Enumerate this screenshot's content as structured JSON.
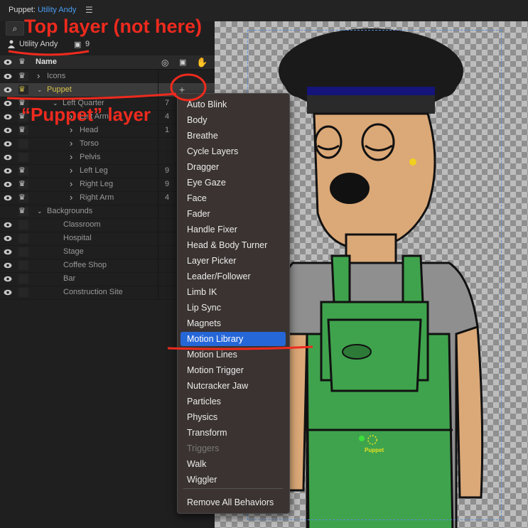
{
  "window": {
    "title_prefix": "Puppet:",
    "title_name": "Utility Andy",
    "menu_icon": "hamburger-icon"
  },
  "puppet_panel": {
    "search_icon": "search-icon",
    "puppet_name": "Utility Andy",
    "count": "9"
  },
  "layers": {
    "header": {
      "name_label": "Name"
    },
    "rows": [
      {
        "label": "Icons",
        "count": ""
      },
      {
        "label": "Puppet",
        "count": ""
      },
      {
        "label": "Left Quarter",
        "count": "7"
      },
      {
        "label": "Left Arm",
        "count": "4"
      },
      {
        "label": "Head",
        "count": "1"
      },
      {
        "label": "Torso",
        "count": ""
      },
      {
        "label": "Pelvis",
        "count": ""
      },
      {
        "label": "Left Leg",
        "count": "9"
      },
      {
        "label": "Right Leg",
        "count": "9"
      },
      {
        "label": "Right Arm",
        "count": "4"
      },
      {
        "label": "Backgrounds",
        "count": ""
      },
      {
        "label": "Classroom",
        "count": ""
      },
      {
        "label": "Hospital",
        "count": ""
      },
      {
        "label": "Stage",
        "count": ""
      },
      {
        "label": "Coffee Shop",
        "count": ""
      },
      {
        "label": "Bar",
        "count": ""
      },
      {
        "label": "Construction Site",
        "count": ""
      }
    ]
  },
  "behaviors_menu": {
    "add_symbol": "+",
    "items": [
      "Auto Blink",
      "Body",
      "Breathe",
      "Cycle Layers",
      "Dragger",
      "Eye Gaze",
      "Face",
      "Fader",
      "Handle Fixer",
      "Head & Body Turner",
      "Layer Picker",
      "Leader/Follower",
      "Limb IK",
      "Lip Sync",
      "Magnets",
      "Motion Library",
      "Motion Lines",
      "Motion Trigger",
      "Nutcracker Jaw",
      "Particles",
      "Physics",
      "Transform",
      "Triggers",
      "Walk",
      "Wiggler"
    ],
    "active_item": "Motion Library",
    "disabled_item": "Triggers",
    "footer_item": "Remove All Behaviors"
  },
  "annotations": {
    "top_layer": "Top layer (not here)",
    "puppet_layer": "“Puppet” layer",
    "color": "#ee2a1e"
  },
  "canvas": {
    "origin_label": "Puppet"
  },
  "colors": {
    "accent": "#2667d8",
    "selected_layer": "#d6c24a",
    "title_name": "#4a9cf0"
  }
}
